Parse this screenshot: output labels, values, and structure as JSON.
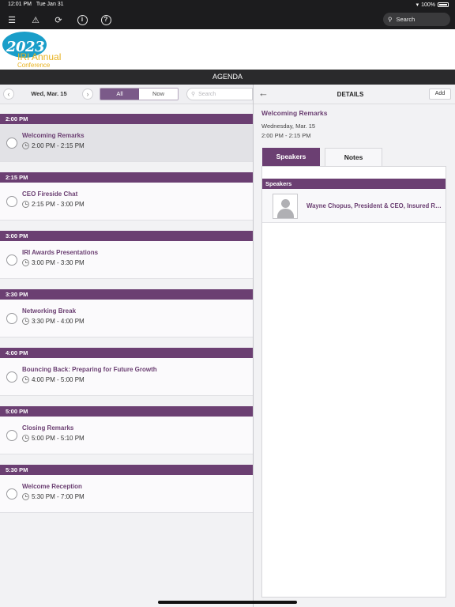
{
  "status_bar": {
    "time": "12:01 PM",
    "date": "Tue Jan 31",
    "battery": "100%"
  },
  "toolbar": {
    "icons": [
      "menu-icon",
      "warning-icon",
      "sync-icon",
      "info-icon",
      "help-icon"
    ],
    "search_label": "Search"
  },
  "banner": {
    "year": "2023",
    "name": "IRI Annual",
    "sub": "Conference"
  },
  "header": {
    "title": "AGENDA"
  },
  "filter": {
    "date": "Wed, Mar. 15",
    "segments": [
      {
        "label": "All"
      },
      {
        "label": "Now"
      }
    ],
    "active_segment": "All",
    "search_placeholder": "Search"
  },
  "sessions": [
    {
      "group": "2:00 PM",
      "title": "Welcoming Remarks",
      "time": "2:00 PM - 2:15 PM"
    },
    {
      "group": "2:15 PM",
      "title": "CEO Fireside Chat",
      "time": "2:15 PM - 3:00 PM"
    },
    {
      "group": "3:00 PM",
      "title": "IRI Awards Presentations",
      "time": "3:00 PM - 3:30 PM"
    },
    {
      "group": "3:30 PM",
      "title": "Networking Break",
      "time": "3:30 PM - 4:00 PM"
    },
    {
      "group": "4:00 PM",
      "title": "Bouncing Back: Preparing for Future Growth",
      "time": "4:00 PM - 5:00 PM"
    },
    {
      "group": "5:00 PM",
      "title": "Closing Remarks",
      "time": "5:00 PM - 5:10 PM"
    },
    {
      "group": "5:30 PM",
      "title": "Welcome Reception",
      "time": "5:30 PM - 7:00 PM"
    }
  ],
  "details": {
    "bar_title": "DETAILS",
    "add_label": "Add",
    "title": "Welcoming Remarks",
    "date": "Wednesday, Mar. 15",
    "time": "2:00 PM - 2:15 PM",
    "tabs": [
      {
        "label": "Speakers"
      },
      {
        "label": "Notes"
      }
    ],
    "speakers_header": "Speakers",
    "speakers": [
      {
        "name": "Wayne Chopus, President & CEO, Insured Retirement Institute"
      }
    ]
  },
  "colors": {
    "accent": "#6b3f72",
    "toolbar": "#1c1c1e",
    "logo_blue": "#1a9ec9",
    "logo_gold": "#e8b21f"
  }
}
